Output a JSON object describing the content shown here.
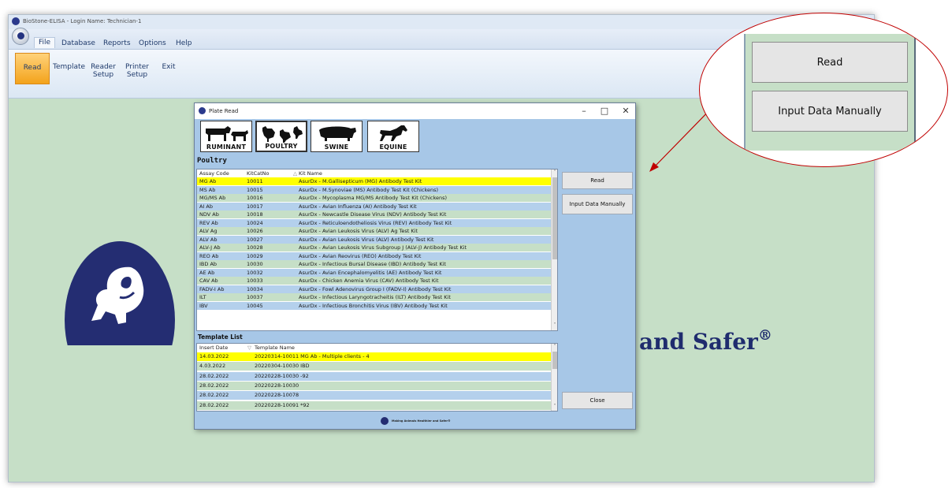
{
  "app": {
    "title": "BioStone-ELISA - Login Name: Technician-1",
    "menu_tabs": [
      "File",
      "Database",
      "Reports",
      "Options",
      "Help"
    ],
    "active_tab": "File",
    "ribbon_buttons": [
      {
        "label": "Read"
      },
      {
        "label": "Template"
      },
      {
        "label": "Reader\nSetup"
      },
      {
        "label": "Printer\nSetup"
      },
      {
        "label": "Exit"
      }
    ],
    "slogan": "and Safer",
    "slogan_mark": "®"
  },
  "dialog": {
    "title": "Plate Read",
    "window_controls": {
      "minimize": "–",
      "maximize": "□",
      "close": "✕"
    },
    "species": [
      {
        "label": "RUMINANT",
        "icon": "cattle-sheep-icon"
      },
      {
        "label": "POULTRY",
        "icon": "poultry-icon"
      },
      {
        "label": "SWINE",
        "icon": "pig-icon"
      },
      {
        "label": "EQUINE",
        "icon": "horse-icon"
      }
    ],
    "section_title": "Poultry",
    "kit_table": {
      "columns": [
        "Assay Code",
        "KitCatNo",
        "Kit Name"
      ],
      "sort_indicator": "△",
      "rows": [
        {
          "code": "MG Ab",
          "cat": "10011",
          "name": "AsurDx - M.Gallisepticum (MG) Antibody Test Kit",
          "selected": true
        },
        {
          "code": "MS Ab",
          "cat": "10015",
          "name": "AsurDx - M.Synoviae (MS) Antibody Test Kit (Chickens)"
        },
        {
          "code": "MG/MS Ab",
          "cat": "10016",
          "name": "AsurDx - Mycoplasma MG/MS Antibody Test Kit (Chickens)"
        },
        {
          "code": "AI Ab",
          "cat": "10017",
          "name": "AsurDx - Avian Influenza (AI) Antibody Test Kit"
        },
        {
          "code": "NDV Ab",
          "cat": "10018",
          "name": "AsurDx - Newcastle Disease Virus (NDV) Antibody Test Kit"
        },
        {
          "code": "REV Ab",
          "cat": "10024",
          "name": "AsurDx - Reticuloendotheliosis Virus (REV) Antibody Test Kit"
        },
        {
          "code": "ALV Ag",
          "cat": "10026",
          "name": "AsurDx - Avian Leukosis Virus (ALV) Ag Test Kit"
        },
        {
          "code": "ALV Ab",
          "cat": "10027",
          "name": "AsurDx - Avian Leukosis Virus (ALV) Antibody Test Kit"
        },
        {
          "code": "ALV-J Ab",
          "cat": "10028",
          "name": "AsurDx - Avian Leukosis Virus Subgroup J (ALV-J) Antibody Test Kit"
        },
        {
          "code": "REO Ab",
          "cat": "10029",
          "name": "AsurDx - Avian Reovirus (REO) Antibody Test Kit"
        },
        {
          "code": "IBD Ab",
          "cat": "10030",
          "name": "AsurDx - Infectious Bursal Disease (IBD) Antibody Test Kit"
        },
        {
          "code": "AE Ab",
          "cat": "10032",
          "name": "AsurDx - Avian Encephalomyelitis (AE) Antibody Test Kit"
        },
        {
          "code": "CAV Ab",
          "cat": "10033",
          "name": "AsurDx - Chicken Anemia Virus (CAV) Antibody Test Kit"
        },
        {
          "code": "FADV-I Ab",
          "cat": "10034",
          "name": "AsurDx - Fowl Adenovirus Group I (FADV-I) Antibody Test Kit"
        },
        {
          "code": "ILT",
          "cat": "10037",
          "name": "AsurDx - Infectious Laryngotracheitis (ILT) Antibody Test Kit"
        },
        {
          "code": "IBV",
          "cat": "10045",
          "name": "AsurDx - Infectious Bronchitis Virus (IBV) Antibody Test Kit"
        }
      ]
    },
    "template_list": {
      "title": "Template List",
      "columns": [
        "Insert Date",
        "Template Name"
      ],
      "sort_indicator": "▽",
      "rows": [
        {
          "date": "14.03.2022",
          "name": "20220314-10011 MG Ab  - Multiple clients - 4",
          "selected": true
        },
        {
          "date": "4.03.2022",
          "name": "20220304-10030 IBD"
        },
        {
          "date": "28.02.2022",
          "name": "20220228-10030 -92"
        },
        {
          "date": "28.02.2022",
          "name": "20220228-10030"
        },
        {
          "date": "28.02.2022",
          "name": "20220228-10078"
        },
        {
          "date": "28.02.2022",
          "name": "20220228-10091 *92"
        }
      ]
    },
    "buttons": {
      "read": "Read",
      "input_manually": "Input Data Manually",
      "close": "Close"
    },
    "footer_text": "Making Animals Healthier and Safer®"
  },
  "callout": {
    "read": "Read",
    "input_manually": "Input Data Manually"
  },
  "colors": {
    "selected_row": "#ffff00",
    "row_blue": "#b4d0ec",
    "row_green": "#c6dfc7",
    "callout_outline": "#c00000",
    "brand_navy": "#242d72"
  }
}
